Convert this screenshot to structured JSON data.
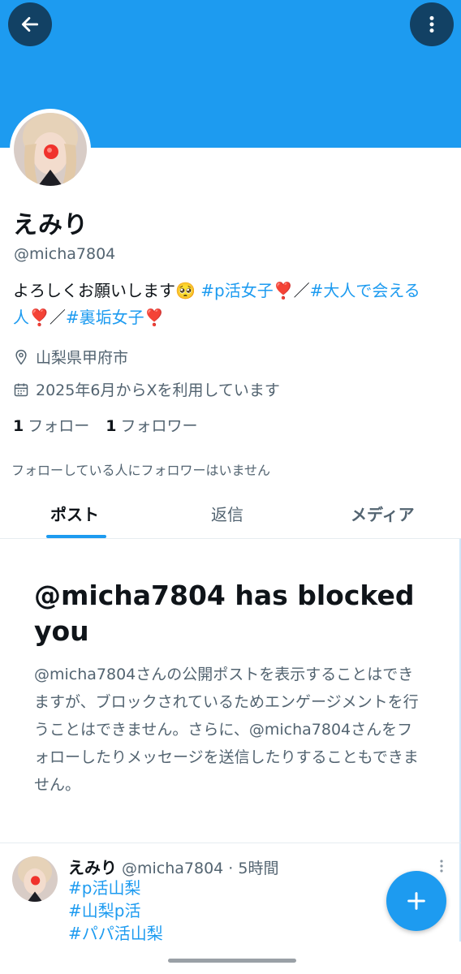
{
  "colors": {
    "accent": "#1d9bf0",
    "text": "#0f1419",
    "secondary": "#536471",
    "heart": "#e0245e"
  },
  "header": {
    "back_icon": "arrow-left-icon",
    "more_icon": "more-vertical-icon"
  },
  "profile": {
    "name": "えみり",
    "handle": "@micha7804",
    "bio": {
      "text1": "よろしくお願いします🥺 ",
      "tag1": "#p活女子",
      "heart1": "❣️",
      "sep1": "／",
      "tag2": "#大人で会える人",
      "heart2": "❣️",
      "sep2": "／",
      "tag3": "#裏垢女子",
      "heart3": "❣️"
    },
    "location": "山梨県甲府市",
    "joined": "2025年6月からXを利用しています",
    "following_count": "1",
    "following_label": "フォロー",
    "followers_count": "1",
    "followers_label": "フォロワー",
    "no_mutual_followers": "フォローしている人にフォロワーはいません"
  },
  "tabs": [
    {
      "label": "ポスト",
      "active": true
    },
    {
      "label": "返信",
      "active": false
    },
    {
      "label": "メディア",
      "active": false
    }
  ],
  "block_notice": {
    "title": "@micha7804 has blocked you",
    "description": "@micha7804さんの公開ポストを表示することはできますが、ブロックされているためエンゲージメントを行うことはできません。さらに、@micha7804さんをフォローしたりメッセージを送信したりすることもできません。"
  },
  "post": {
    "name": "えみり",
    "meta": "@micha7804 · 5時間",
    "tags": [
      "#p活山梨",
      "#山梨p活",
      "#パパ活山梨"
    ]
  },
  "fab_icon": "plus-icon"
}
